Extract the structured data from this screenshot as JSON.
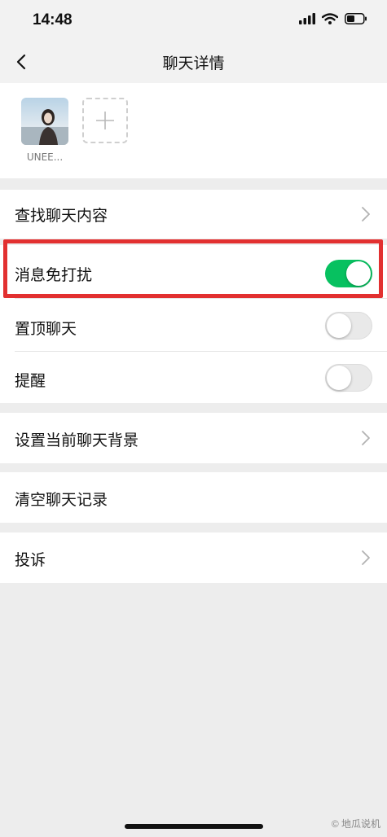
{
  "status_bar": {
    "time": "14:48"
  },
  "nav": {
    "title": "聊天详情"
  },
  "members": [
    {
      "name": "UNEE..."
    }
  ],
  "settings": {
    "search_history": "查找聊天内容",
    "mute": {
      "label": "消息免打扰",
      "on": true
    },
    "pin": {
      "label": "置顶聊天",
      "on": false
    },
    "remind": {
      "label": "提醒",
      "on": false
    },
    "background": "设置当前聊天背景",
    "clear_history": "清空聊天记录",
    "report": "投诉"
  },
  "watermark": "© 地瓜说机",
  "colors": {
    "toggle_on": "#07c160",
    "highlight": "#e23030"
  },
  "icons": [
    "back-icon",
    "add-member-icon",
    "chevron-right-icon",
    "signal-icon",
    "wifi-icon",
    "battery-icon"
  ]
}
